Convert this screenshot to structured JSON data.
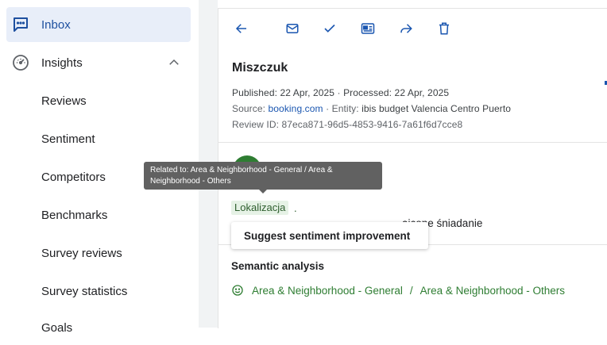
{
  "sidebar": {
    "inbox": {
      "label": "Inbox",
      "icon": "message-square-icon"
    },
    "insights": {
      "label": "Insights",
      "icon": "gauge-icon"
    },
    "items": [
      {
        "label": "Reviews"
      },
      {
        "label": "Sentiment"
      },
      {
        "label": "Competitors"
      },
      {
        "label": "Benchmarks"
      },
      {
        "label": "Survey reviews"
      },
      {
        "label": "Survey statistics"
      },
      {
        "label": "Goals"
      }
    ]
  },
  "toolbar": {
    "icons": [
      "arrow-left-icon",
      "mail-icon",
      "check-icon",
      "id-card-icon",
      "share-icon",
      "trash-icon"
    ]
  },
  "review": {
    "author": "Miszczuk",
    "published_label": "Published:",
    "published": "22 Apr, 2025",
    "processed_label": "Processed:",
    "processed": "22 Apr, 2025",
    "source_label": "Source:",
    "source": "booking.com",
    "entity_label": "Entity:",
    "entity": "ibis budget Valencia Centro Puerto",
    "review_id_label": "Review ID:",
    "review_id": "87eca871-96d5-4853-9416-7a61f6d7cce8",
    "keyword": "Lokalizacja",
    "keyword_punct": ".",
    "text_fragment": "aicone śniadanie"
  },
  "tooltip": {
    "text": "Related to: Area & Neighborhood - General / Area & Neighborhood - Others"
  },
  "menu": {
    "suggest_label": "Suggest sentiment improvement"
  },
  "semantic": {
    "title": "Semantic analysis",
    "category": "Area & Neighborhood - General",
    "separator": "/",
    "subcategory": "Area & Neighborhood - Others"
  },
  "colors": {
    "accent": "#1a56b0",
    "positive": "#2e7d32",
    "active_bg": "#e8eef9"
  }
}
